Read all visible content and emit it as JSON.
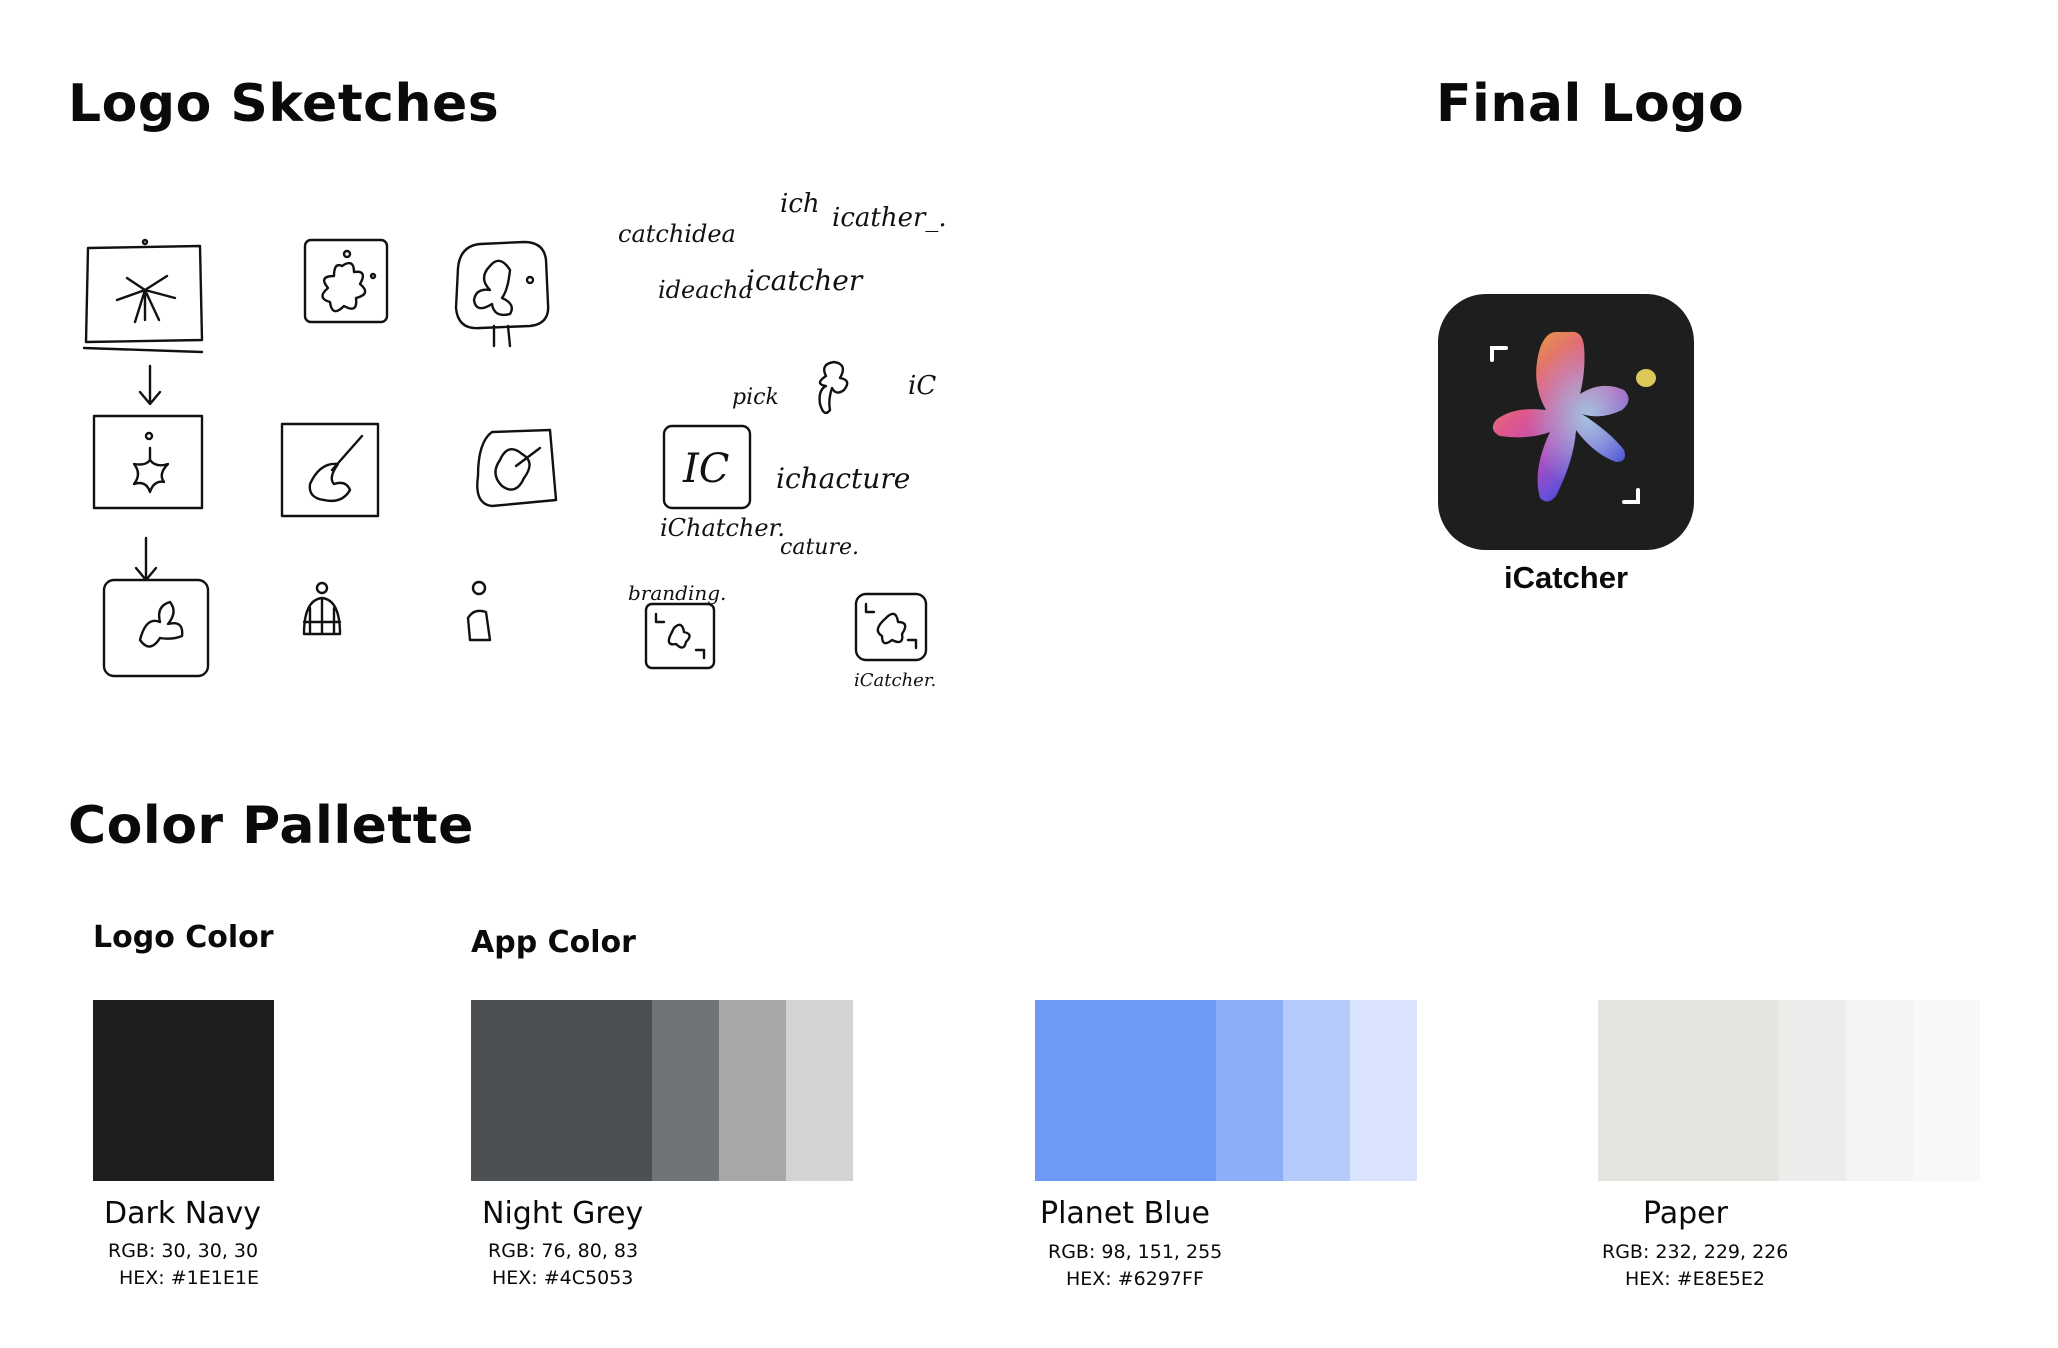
{
  "headings": {
    "sketches": "Logo Sketches",
    "final": "Final Logo",
    "palette": "Color Pallette"
  },
  "sketch_notes": [
    "ich",
    "icather_.",
    "catchidea",
    "ideacha",
    "icatcher",
    "pick",
    "iC",
    "IC",
    "ichacture",
    "iChatcher.",
    "cature.",
    "branding.",
    "iCatcher."
  ],
  "final_logo": {
    "app_name": "iCatcher",
    "icon_background": "#1E1E1E"
  },
  "palette": {
    "logo_color_title": "Logo Color",
    "app_color_title": "App Color",
    "colors": [
      {
        "name": "Dark Navy",
        "rgb": "RGB: 30, 30, 30",
        "hex": "HEX: #1E1E1E",
        "swatches": [
          "#1E1E1E"
        ]
      },
      {
        "name": "Night Grey",
        "rgb": "RGB: 76, 80, 83",
        "hex": "HEX: #4C5053",
        "swatches": [
          "#4C5053",
          "#717477",
          "#A5A7A8",
          "#D2D3D4"
        ]
      },
      {
        "name": "Planet Blue",
        "rgb": "RGB: 98, 151, 255",
        "hex": "HEX: #6297FF",
        "swatches": [
          "#6E9AF6",
          "#8CAEF8",
          "#B7CBFA",
          "#DAE4FC"
        ]
      },
      {
        "name": "Paper",
        "rgb": "RGB: 232, 229, 226",
        "hex": "HEX: #E8E5E2",
        "swatches": [
          "#E6E4E1",
          "#EDECEA",
          "#F3F3F2",
          "#F8F8F8"
        ]
      }
    ]
  }
}
